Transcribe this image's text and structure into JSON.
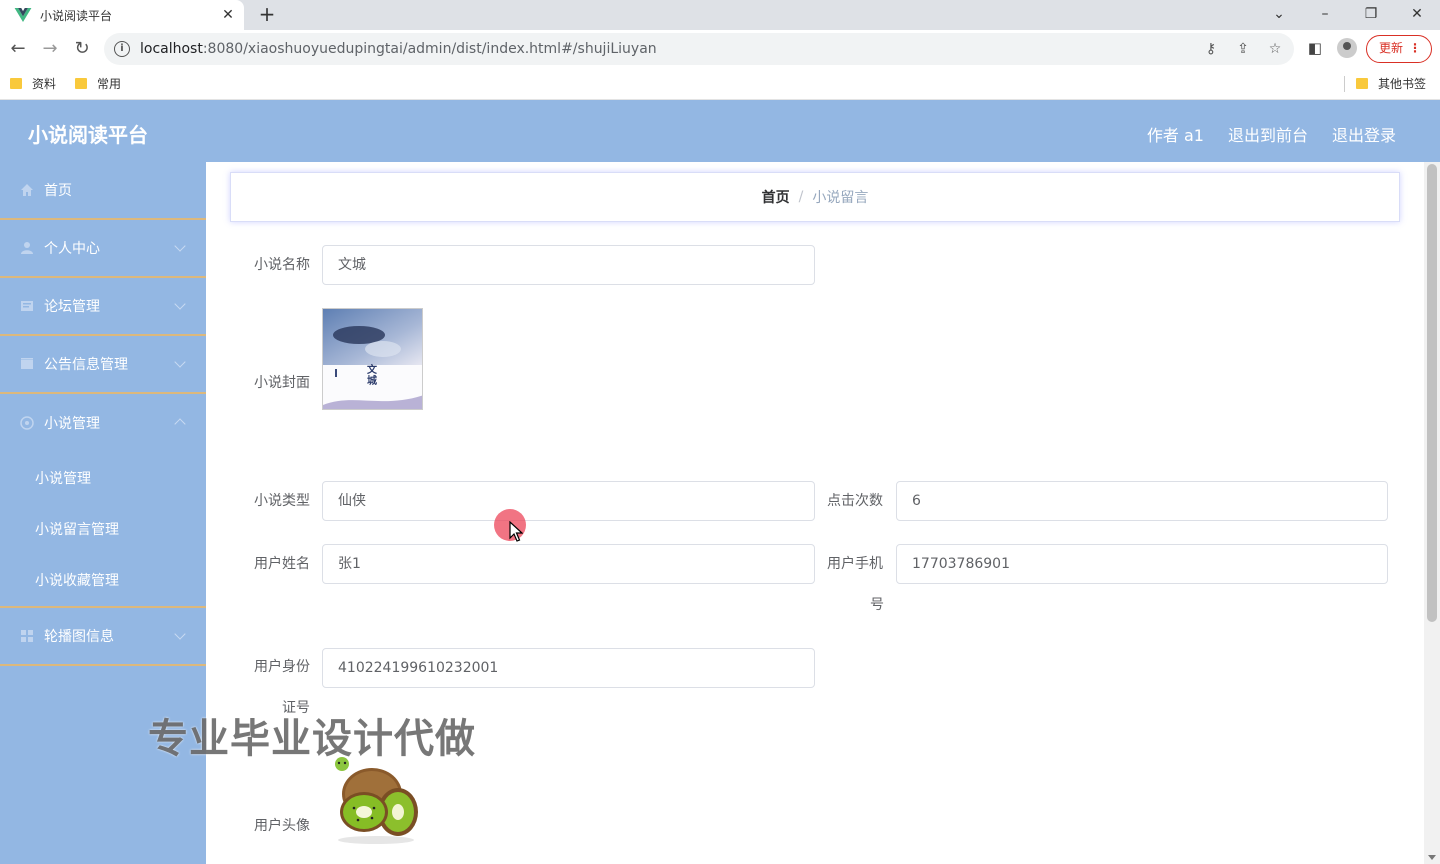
{
  "browser": {
    "tab_title": "小说阅读平台",
    "tab_close": "✕",
    "new_tab": "+",
    "url_host": "localhost",
    "url_path": ":8080/xiaoshuoyuedupingtai/admin/dist/index.html#/shujiLiuyan",
    "update_label": "更新",
    "bookmarks": [
      "资料",
      "常用"
    ],
    "other_bookmarks": "其他书签"
  },
  "header": {
    "title": "小说阅读平台",
    "links": [
      "作者 a1",
      "退出到前台",
      "退出登录"
    ]
  },
  "sidebar": {
    "items": [
      {
        "label": "首页",
        "icon": "home-icon"
      },
      {
        "label": "个人中心",
        "icon": "user-icon"
      },
      {
        "label": "论坛管理",
        "icon": "forum-icon"
      },
      {
        "label": "公告信息管理",
        "icon": "notice-icon"
      },
      {
        "label": "小说管理",
        "icon": "book-icon"
      }
    ],
    "subitems": [
      "小说管理",
      "小说留言管理",
      "小说收藏管理"
    ],
    "last_item": {
      "label": "轮播图信息",
      "icon": "grid-icon"
    }
  },
  "breadcrumb": {
    "home": "首页",
    "separator": "/",
    "current": "小说留言"
  },
  "form": {
    "novel_name_label": "小说名称",
    "novel_name_value": "文城",
    "cover_label": "小说封面",
    "cover_title": "文城",
    "type_label": "小说类型",
    "type_value": "仙侠",
    "clicks_label": "点击次数",
    "clicks_value": "6",
    "user_name_label": "用户姓名",
    "user_name_value": "张1",
    "phone_label_1": "用户手机",
    "phone_label_2": "号",
    "phone_value": "17703786901",
    "id_label_1": "用户身份",
    "id_label_2": "证号",
    "id_value": "410224199610232001",
    "avatar_label": "用户头像"
  },
  "watermark": "专业毕业设计代做",
  "colors": {
    "header_bg": "#93b7e3",
    "sidebar_divider": "#dcb87c",
    "breadcrumb_glow": "#7882ff"
  }
}
